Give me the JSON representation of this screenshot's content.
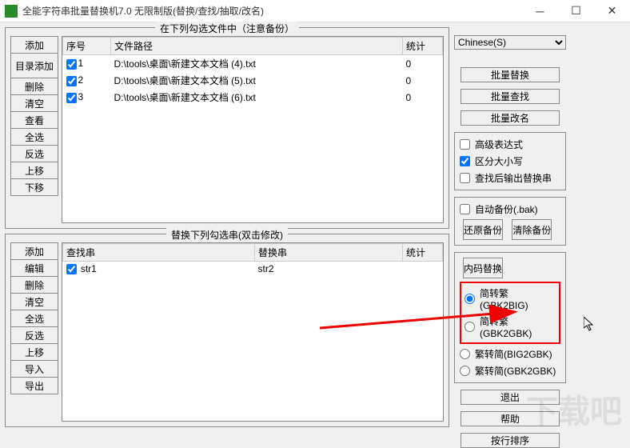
{
  "title": "全能字符串批量替换机7.0 无限制版(替换/查找/抽取/改名)",
  "panels": {
    "files": {
      "title": "在下列勾选文件中（注意备份）",
      "buttons": [
        "添加",
        "目录添加",
        "删除",
        "清空",
        "查看",
        "全选",
        "反选",
        "上移",
        "下移"
      ],
      "headers": {
        "seq": "序号",
        "path": "文件路径",
        "count": "统计"
      },
      "rows": [
        {
          "checked": true,
          "seq": "1",
          "path": "D:\\tools\\桌面\\新建文本文档 (4).txt",
          "count": "0"
        },
        {
          "checked": true,
          "seq": "2",
          "path": "D:\\tools\\桌面\\新建文本文档 (5).txt",
          "count": "0"
        },
        {
          "checked": true,
          "seq": "3",
          "path": "D:\\tools\\桌面\\新建文本文档 (6).txt",
          "count": "0"
        }
      ]
    },
    "replace": {
      "title": "替换下列勾选串(双击修改)",
      "buttons": [
        "添加",
        "编辑",
        "删除",
        "清空",
        "全选",
        "反选",
        "上移",
        "导入",
        "导出"
      ],
      "headers": {
        "find": "查找串",
        "rep": "替换串",
        "count": "统计"
      },
      "rows": [
        {
          "checked": true,
          "find": "str1",
          "rep": "str2",
          "count": ""
        }
      ]
    }
  },
  "right": {
    "lang": "Chinese(S)",
    "batch_replace": "批量替换",
    "batch_find": "批量查找",
    "batch_rename": "批量改名",
    "adv_expr": "高级表达式",
    "case_sens": "区分大小写",
    "output_str": "查找后输出替换串",
    "auto_backup": "自动备份(.bak)",
    "restore": "还原备份",
    "clear_backup": "清除备份",
    "encode_replace": "内码替换",
    "enc1": "简转繁(GBK2BIG)",
    "enc2": "简转繁(GBK2GBK)",
    "enc3": "繁转简(BIG2GBK)",
    "enc4": "繁转简(GBK2GBK)",
    "exit": "退出",
    "help": "帮助",
    "sort": "按行排序"
  },
  "watermark": "下载吧"
}
